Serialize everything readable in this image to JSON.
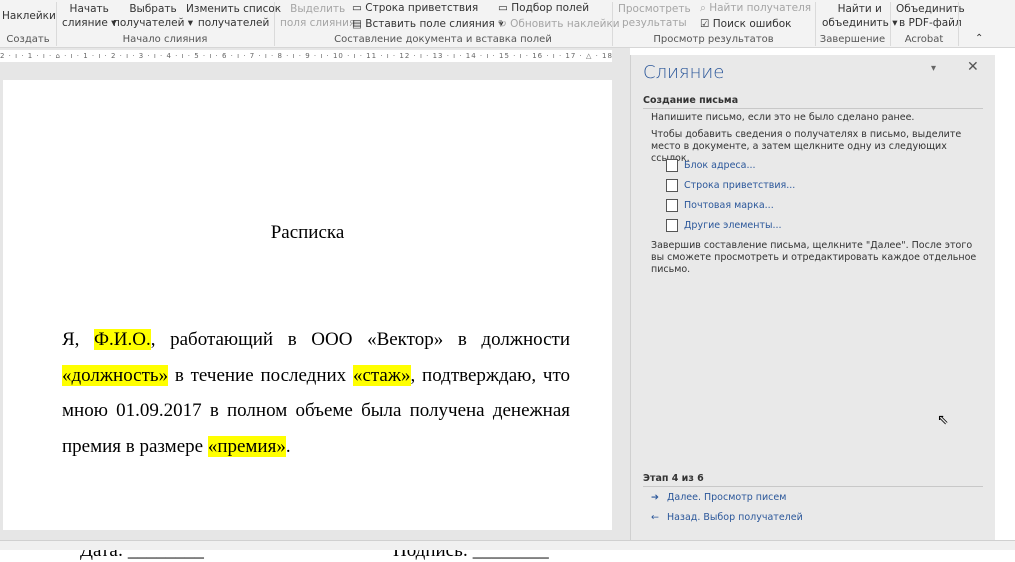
{
  "ribbon": {
    "labels": "Наклейки",
    "start": "Начать",
    "start2": "слияние",
    "select": "Выбрать",
    "select2": "получателей",
    "edit": "Изменить список",
    "edit2": "получателей",
    "highlight": "Выделить",
    "highlight2": "поля слияния",
    "greeting": "Строка приветствия",
    "insert_field": "Вставить поле слияния",
    "match": "Подбор полей",
    "update": "Обновить наклейки",
    "preview": "Просмотреть",
    "preview2": "результаты",
    "find_recipient": "Найти получателя",
    "check_errors": "Поиск ошибок",
    "finish": "Найти и",
    "finish2": "объединить",
    "pdf": "Объединить",
    "pdf2": "в PDF-файл",
    "groups": [
      "Создать",
      "Начало слияния",
      "Составление документа и вставка полей",
      "Просмотр результатов",
      "Завершение",
      "Acrobat"
    ]
  },
  "ruler": "2 · ı · 1 · ı · ⌂ · ı · 1 · ı · 2 · ı · 3 · ı · 4 · ı · 5 · ı · 6 · ı · 7 · ı · 8 · ı · 9 · ı · 10 · ı · 11 · ı · 12 · ı · 13 · ı · 14 · ı · 15 · ı · 16 · ı · 17 · △ · 18 · ı ·",
  "document": {
    "title": "Расписка",
    "p": [
      "Я, ",
      "Ф.И.О.",
      ", работающий в ООО «Вектор» в должности ",
      "«должность»",
      " в течение последних ",
      "«стаж»",
      ", подтверждаю, что мною 01.09.2017 в полном объеме была получена денежная премия в размере ",
      "«премия»",
      "."
    ],
    "date": "Дата: ________",
    "signature": "Подпись: ________"
  },
  "pane": {
    "title": "Слияние",
    "section": "Создание письма",
    "t1": "Напишите письмо, если это не было сделано ранее.",
    "t2": "Чтобы добавить сведения о получателях в письмо, выделите место в документе, а затем щелкните одну из следующих ссылок.",
    "links": [
      "Блок адреса...",
      "Строка приветствия...",
      "Почтовая марка...",
      "Другие элементы..."
    ],
    "t3": "Завершив составление письма, щелкните \"Далее\". После этого вы сможете просмотреть и отредактировать каждое отдельное письмо.",
    "step": "Этап 4 из 6",
    "next": "Далее. Просмотр писем",
    "back": "Назад. Выбор получателей"
  }
}
